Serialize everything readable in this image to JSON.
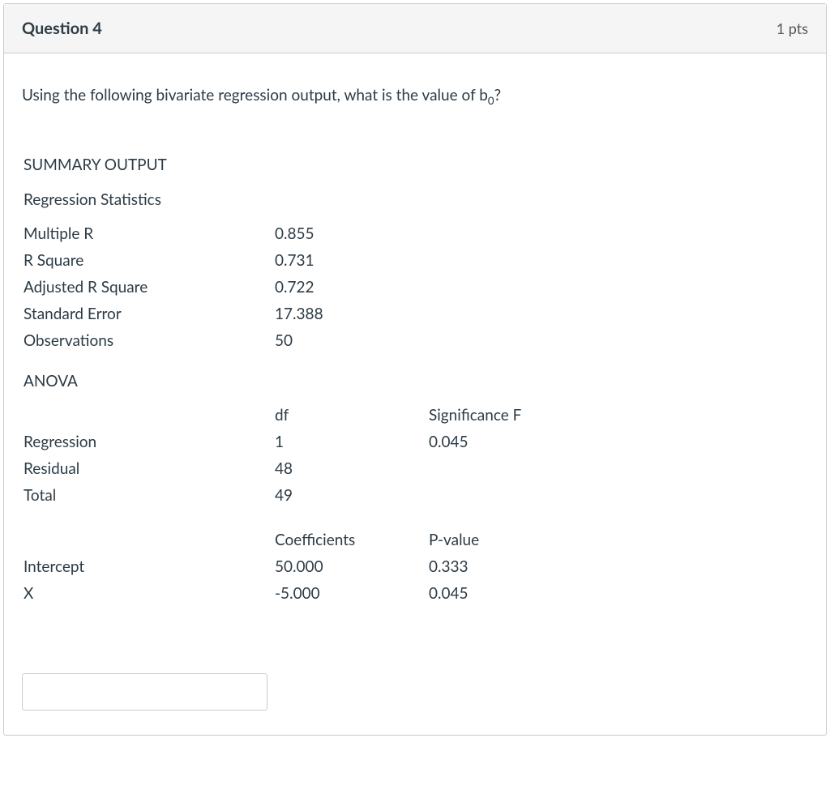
{
  "header": {
    "title": "Question 4",
    "points": "1 pts"
  },
  "prompt": {
    "before_sub": "Using the following bivariate regression output, what is the value of b",
    "subscript": "0",
    "after_sub": "?"
  },
  "summary": {
    "title": "SUMMARY OUTPUT",
    "stats_title": "Regression Statistics",
    "rows": [
      {
        "label": "Multiple R",
        "value": "0.855"
      },
      {
        "label": "R Square",
        "value": "0.731"
      },
      {
        "label": "Adjusted R Square",
        "value": "0.722"
      },
      {
        "label": "Standard Error",
        "value": "17.388"
      },
      {
        "label": "Observations",
        "value": "50"
      }
    ]
  },
  "anova": {
    "title": "ANOVA",
    "header": {
      "col1": "df",
      "col2": "Significance F"
    },
    "rows": [
      {
        "label": "Regression",
        "col1": "1",
        "col2": "0.045"
      },
      {
        "label": "Residual",
        "col1": "48",
        "col2": ""
      },
      {
        "label": "Total",
        "col1": "49",
        "col2": ""
      }
    ]
  },
  "coeff": {
    "header": {
      "col1": "Coefficients",
      "col2": "P-value"
    },
    "rows": [
      {
        "label": "Intercept",
        "col1": "50.000",
        "col2": "0.333"
      },
      {
        "label": "X",
        "col1": "-5.000",
        "col2": "0.045"
      }
    ]
  },
  "answer": {
    "value": "",
    "placeholder": ""
  }
}
